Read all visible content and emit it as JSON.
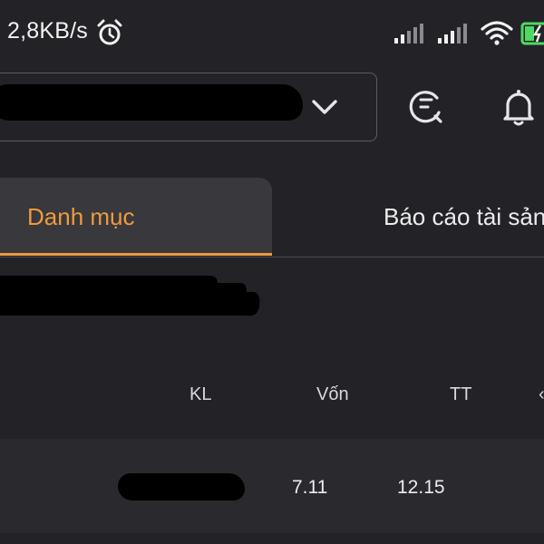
{
  "status_bar": {
    "network_speed": "2,8KB/s",
    "icons": [
      "alarm-icon",
      "signal-icon",
      "signal-icon",
      "wifi-icon",
      "battery-charging-icon"
    ],
    "accent": "#4cd964"
  },
  "header": {
    "account_value": "",
    "icons": [
      "chevron-down-icon",
      "history-search-icon",
      "bell-icon"
    ]
  },
  "tabs": [
    {
      "label": "Danh mục",
      "active": true
    },
    {
      "label": "Báo cáo tài sản",
      "active": false
    }
  ],
  "table": {
    "columns": [
      "KL",
      "Vốn",
      "TT"
    ],
    "rows": [
      {
        "symbol": "",
        "von": "7.11",
        "tt": "12.15"
      }
    ]
  },
  "colors": {
    "background": "#232327",
    "accent_orange": "#ef9a3c",
    "active_tab_bg": "#38383d"
  }
}
